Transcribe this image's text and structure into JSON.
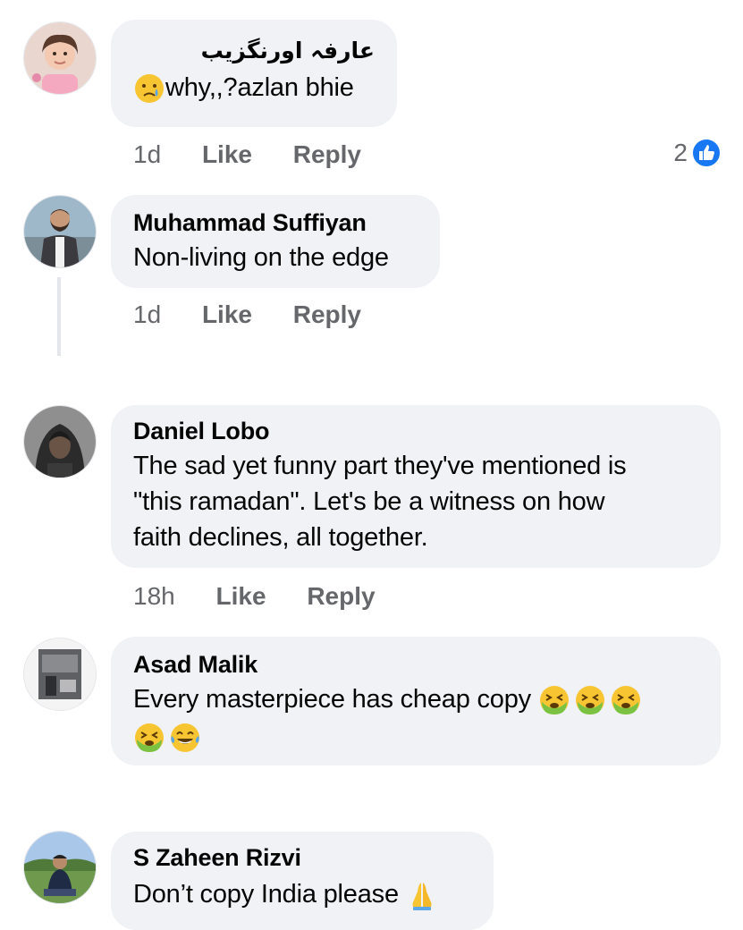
{
  "comments": [
    {
      "author": "عارفہ اورنگزیب",
      "text": "why,,?azlan bhie",
      "emoji_lead": "sad-tear-emoji",
      "time": "1d",
      "like": "Like",
      "reply": "Reply",
      "reaction_count": "2",
      "reaction_icon": "like-icon"
    },
    {
      "author": "Muhammad Suffiyan",
      "text": "Non-living on the edge",
      "time": "1d",
      "like": "Like",
      "reply": "Reply"
    },
    {
      "author": "Daniel Lobo",
      "text_lines": [
        "The sad yet funny part they've mentioned is",
        "\"this ramadan\". Let's be a witness on how",
        "faith declines, all together."
      ],
      "time": "18h",
      "like": "Like",
      "reply": "Reply"
    },
    {
      "author": "Asad Malik",
      "text": "Every masterpiece has cheap copy",
      "emojis": [
        "nauseated-face-emoji",
        "nauseated-face-emoji",
        "nauseated-face-emoji",
        "nauseated-face-emoji",
        "tears-of-joy-emoji"
      ]
    },
    {
      "author": "S Zaheen Rizvi",
      "text": "Don’t copy India please",
      "emoji_trail": "folded-hands-emoji"
    }
  ],
  "colors": {
    "bubble": "#f0f2f5",
    "muted": "#65676b",
    "like_blue": "#1877f2",
    "nausea_green": "#7cc242",
    "emoji_yellow": "#f7c531"
  }
}
